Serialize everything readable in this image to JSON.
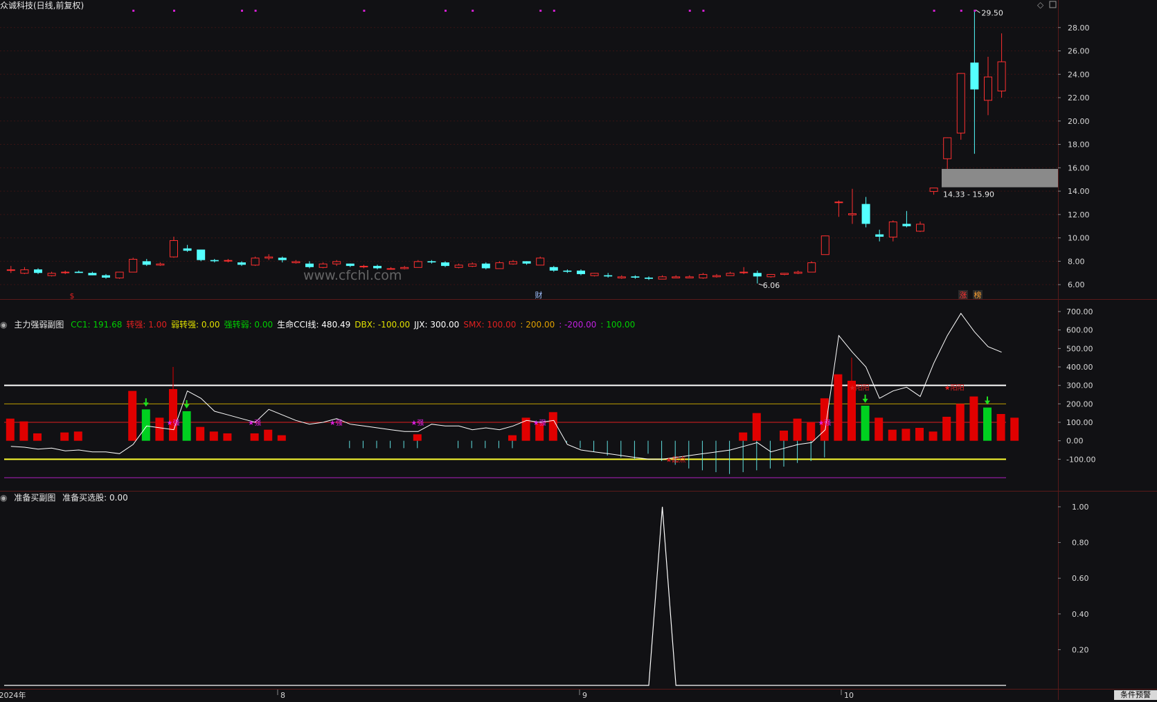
{
  "main_panel": {
    "title": "众诚科技(日线,前复权)",
    "price_axis": [
      "28.00",
      "26.00",
      "24.00",
      "22.00",
      "20.00",
      "18.00",
      "16.00",
      "14.00",
      "12.00",
      "10.00",
      "8.00",
      "6.00"
    ],
    "high_label": "29.50",
    "low_label": "6.06",
    "zone_label": "14.33 - 15.90",
    "markers": {
      "s_label": "$",
      "cai_label": "财",
      "zhang_label": "涨",
      "bang_label": "榜"
    },
    "watermark": "www.cfchl.com"
  },
  "sub_panel1": {
    "name": "主力强弱副图",
    "items": [
      {
        "label": "CC1: 191.68",
        "color": "#00d000"
      },
      {
        "label": "转强: 1.00",
        "color": "#e02020"
      },
      {
        "label": "弱转强: 0.00",
        "color": "#e0e000"
      },
      {
        "label": "强转弱: 0.00",
        "color": "#00d000"
      },
      {
        "label": "生命CCI线: 480.49",
        "color": "#ffffff"
      },
      {
        "label": "DBX: -100.00",
        "color": "#e0e000"
      },
      {
        "label": "JJX: 300.00",
        "color": "#ffffff"
      },
      {
        "label": "SMX: 100.00",
        "color": "#e02020"
      },
      {
        "label": ": 200.00",
        "color": "#e0a000"
      },
      {
        "label": ": -200.00",
        "color": "#c020e0"
      },
      {
        "label": ": 100.00",
        "color": "#00d000"
      }
    ],
    "axis": [
      "700.00",
      "600.00",
      "500.00",
      "400.00",
      "300.00",
      "200.00",
      "100.00",
      "0.00",
      "-100.00"
    ],
    "annotations": {
      "qiang": "★强",
      "huan_yang": "★阳阳",
      "qi_dian": "★起点"
    }
  },
  "sub_panel2": {
    "name": "准备买副图",
    "value_label": "准备买选股: 0.00",
    "axis": [
      "1.00",
      "0.80",
      "0.60",
      "0.40",
      "0.20"
    ]
  },
  "time_axis": [
    "2024年",
    "8",
    "9",
    "10"
  ],
  "corner_button": "条件预警",
  "colors": {
    "up": "#ff3030",
    "down": "#54ffff",
    "bg": "#111114",
    "grid": "#3a1010"
  },
  "chart_data": {
    "type": "candlestick",
    "ylim": [
      5,
      30
    ],
    "candles": [
      {
        "o": 7.3,
        "h": 7.6,
        "l": 7.0,
        "c": 7.3
      },
      {
        "o": 7.0,
        "h": 7.5,
        "l": 6.9,
        "c": 7.3
      },
      {
        "o": 7.3,
        "h": 7.4,
        "l": 6.9,
        "c": 7.0
      },
      {
        "o": 6.8,
        "h": 7.1,
        "l": 6.7,
        "c": 7.0
      },
      {
        "o": 7.1,
        "h": 7.2,
        "l": 6.9,
        "c": 7.1
      },
      {
        "o": 7.1,
        "h": 7.2,
        "l": 7.0,
        "c": 7.0
      },
      {
        "o": 7.0,
        "h": 7.1,
        "l": 6.8,
        "c": 6.8
      },
      {
        "o": 6.8,
        "h": 6.9,
        "l": 6.5,
        "c": 6.6
      },
      {
        "o": 6.6,
        "h": 7.1,
        "l": 6.5,
        "c": 7.1
      },
      {
        "o": 7.1,
        "h": 8.3,
        "l": 7.1,
        "c": 8.2
      },
      {
        "o": 8.0,
        "h": 8.2,
        "l": 7.6,
        "c": 7.7
      },
      {
        "o": 7.7,
        "h": 7.9,
        "l": 7.6,
        "c": 7.8
      },
      {
        "o": 8.4,
        "h": 10.1,
        "l": 8.3,
        "c": 9.8
      },
      {
        "o": 9.1,
        "h": 9.4,
        "l": 8.8,
        "c": 8.9
      },
      {
        "o": 9.0,
        "h": 9.0,
        "l": 8.0,
        "c": 8.1
      },
      {
        "o": 8.1,
        "h": 8.2,
        "l": 7.9,
        "c": 8.0
      },
      {
        "o": 8.1,
        "h": 8.2,
        "l": 7.9,
        "c": 8.1
      },
      {
        "o": 7.9,
        "h": 8.0,
        "l": 7.6,
        "c": 7.7
      },
      {
        "o": 7.7,
        "h": 8.4,
        "l": 7.6,
        "c": 8.3
      },
      {
        "o": 8.3,
        "h": 8.6,
        "l": 8.1,
        "c": 8.4
      },
      {
        "o": 8.3,
        "h": 8.4,
        "l": 7.9,
        "c": 8.1
      },
      {
        "o": 7.9,
        "h": 8.1,
        "l": 7.8,
        "c": 8.0
      },
      {
        "o": 7.8,
        "h": 8.0,
        "l": 7.4,
        "c": 7.5
      },
      {
        "o": 7.5,
        "h": 7.9,
        "l": 7.4,
        "c": 7.8
      },
      {
        "o": 7.8,
        "h": 8.1,
        "l": 7.6,
        "c": 8.0
      },
      {
        "o": 7.8,
        "h": 7.8,
        "l": 7.5,
        "c": 7.6
      },
      {
        "o": 7.6,
        "h": 7.7,
        "l": 7.4,
        "c": 7.6
      },
      {
        "o": 7.6,
        "h": 7.7,
        "l": 7.3,
        "c": 7.4
      },
      {
        "o": 7.4,
        "h": 7.5,
        "l": 7.3,
        "c": 7.4
      },
      {
        "o": 7.4,
        "h": 7.6,
        "l": 7.3,
        "c": 7.5
      },
      {
        "o": 7.5,
        "h": 8.1,
        "l": 7.5,
        "c": 8.0
      },
      {
        "o": 8.0,
        "h": 8.1,
        "l": 7.8,
        "c": 7.9
      },
      {
        "o": 7.9,
        "h": 8.0,
        "l": 7.5,
        "c": 7.6
      },
      {
        "o": 7.5,
        "h": 7.8,
        "l": 7.4,
        "c": 7.7
      },
      {
        "o": 7.6,
        "h": 7.9,
        "l": 7.5,
        "c": 7.8
      },
      {
        "o": 7.8,
        "h": 7.9,
        "l": 7.3,
        "c": 7.4
      },
      {
        "o": 7.4,
        "h": 8.0,
        "l": 7.4,
        "c": 7.9
      },
      {
        "o": 7.8,
        "h": 8.1,
        "l": 7.7,
        "c": 8.0
      },
      {
        "o": 8.0,
        "h": 8.0,
        "l": 7.7,
        "c": 7.8
      },
      {
        "o": 7.7,
        "h": 8.4,
        "l": 7.7,
        "c": 8.3
      },
      {
        "o": 7.5,
        "h": 7.6,
        "l": 7.1,
        "c": 7.2
      },
      {
        "o": 7.2,
        "h": 7.3,
        "l": 7.0,
        "c": 7.1
      },
      {
        "o": 7.2,
        "h": 7.3,
        "l": 6.8,
        "c": 6.9
      },
      {
        "o": 6.8,
        "h": 7.0,
        "l": 6.7,
        "c": 7.0
      },
      {
        "o": 6.8,
        "h": 7.0,
        "l": 6.6,
        "c": 6.7
      },
      {
        "o": 6.6,
        "h": 6.8,
        "l": 6.5,
        "c": 6.7
      },
      {
        "o": 6.7,
        "h": 6.8,
        "l": 6.5,
        "c": 6.6
      },
      {
        "o": 6.6,
        "h": 6.7,
        "l": 6.4,
        "c": 6.5
      },
      {
        "o": 6.5,
        "h": 6.8,
        "l": 6.5,
        "c": 6.7
      },
      {
        "o": 6.6,
        "h": 6.8,
        "l": 6.6,
        "c": 6.7
      },
      {
        "o": 6.6,
        "h": 6.8,
        "l": 6.6,
        "c": 6.7
      },
      {
        "o": 6.6,
        "h": 7.0,
        "l": 6.5,
        "c": 6.9
      },
      {
        "o": 6.7,
        "h": 6.9,
        "l": 6.6,
        "c": 6.8
      },
      {
        "o": 6.8,
        "h": 7.1,
        "l": 6.8,
        "c": 7.0
      },
      {
        "o": 7.1,
        "h": 7.5,
        "l": 6.9,
        "c": 7.1
      },
      {
        "o": 7.0,
        "h": 7.2,
        "l": 6.1,
        "c": 6.7
      },
      {
        "o": 6.7,
        "h": 6.9,
        "l": 6.6,
        "c": 6.9
      },
      {
        "o": 6.9,
        "h": 7.0,
        "l": 6.8,
        "c": 7.0
      },
      {
        "o": 7.0,
        "h": 7.2,
        "l": 6.9,
        "c": 7.1
      },
      {
        "o": 7.1,
        "h": 8.0,
        "l": 7.1,
        "c": 7.9
      },
      {
        "o": 8.6,
        "h": 10.2,
        "l": 8.6,
        "c": 10.2
      },
      {
        "o": 13.1,
        "h": 13.2,
        "l": 11.8,
        "c": 13.1
      },
      {
        "o": 12.0,
        "h": 14.2,
        "l": 11.2,
        "c": 12.1
      },
      {
        "o": 12.9,
        "h": 13.5,
        "l": 10.9,
        "c": 11.2
      },
      {
        "o": 10.3,
        "h": 10.7,
        "l": 9.7,
        "c": 10.1
      },
      {
        "o": 10.1,
        "h": 11.5,
        "l": 9.7,
        "c": 11.4
      },
      {
        "o": 11.2,
        "h": 12.3,
        "l": 10.9,
        "c": 11.0
      },
      {
        "o": 10.6,
        "h": 11.4,
        "l": 10.5,
        "c": 11.2
      },
      {
        "o": 14.0,
        "h": 14.3,
        "l": 13.7,
        "c": 14.3
      },
      {
        "o": 16.8,
        "h": 18.6,
        "l": 15.9,
        "c": 18.6
      },
      {
        "o": 19.0,
        "h": 24.1,
        "l": 18.4,
        "c": 24.1
      },
      {
        "o": 25.0,
        "h": 29.5,
        "l": 17.2,
        "c": 22.7
      },
      {
        "o": 21.8,
        "h": 25.5,
        "l": 20.5,
        "c": 23.8
      },
      {
        "o": 22.6,
        "h": 27.5,
        "l": 22.0,
        "c": 25.1
      }
    ],
    "cc1": [
      120,
      105,
      40,
      0,
      45,
      50,
      0,
      0,
      0,
      270,
      170,
      125,
      280,
      160,
      75,
      50,
      40,
      0,
      40,
      60,
      30,
      0,
      0,
      0,
      0,
      0,
      0,
      0,
      0,
      0,
      35,
      0,
      0,
      0,
      0,
      0,
      0,
      30,
      125,
      95,
      155,
      0,
      0,
      0,
      0,
      0,
      0,
      0,
      0,
      0,
      0,
      0,
      0,
      0,
      45,
      150,
      0,
      55,
      120,
      100,
      230,
      360,
      325,
      190,
      125,
      60,
      65,
      70,
      50,
      130,
      200,
      240,
      180,
      145,
      125
    ],
    "cc1_colors": [
      0,
      0,
      0,
      0,
      0,
      0,
      0,
      0,
      0,
      0,
      1,
      0,
      0,
      1,
      0,
      0,
      0,
      0,
      0,
      0,
      0,
      0,
      0,
      0,
      0,
      0,
      0,
      0,
      0,
      0,
      0,
      0,
      0,
      0,
      0,
      0,
      0,
      0,
      0,
      0,
      0,
      0,
      0,
      0,
      0,
      0,
      0,
      0,
      0,
      0,
      0,
      0,
      0,
      0,
      0,
      0,
      0,
      0,
      0,
      0,
      0,
      0,
      0,
      1,
      0,
      0,
      0,
      0,
      0,
      0,
      0,
      0,
      1,
      0,
      0
    ],
    "cyan_lines": [
      -10,
      -40,
      -60,
      -80,
      -90,
      -100,
      -70,
      -110,
      -130,
      -150,
      -160,
      -170,
      -180,
      -170,
      -160,
      -150,
      -140,
      -120,
      -110,
      -90
    ],
    "life_cci": [
      -30,
      -35,
      -45,
      -40,
      -55,
      -50,
      -60,
      -60,
      -70,
      -20,
      80,
      70,
      60,
      270,
      230,
      160,
      140,
      120,
      100,
      170,
      140,
      110,
      90,
      100,
      120,
      90,
      80,
      70,
      60,
      50,
      50,
      90,
      80,
      80,
      60,
      70,
      60,
      80,
      110,
      100,
      110,
      -20,
      -50,
      -60,
      -70,
      -80,
      -90,
      -100,
      -100,
      -90,
      -80,
      -70,
      -60,
      -50,
      -30,
      -10,
      -60,
      -40,
      -20,
      -10,
      60,
      570,
      480,
      400,
      230,
      270,
      290,
      240,
      420,
      570,
      690,
      590,
      510,
      480
    ],
    "dbx": -100,
    "jjx": 300,
    "smx": 100,
    "line200": 200,
    "line_neg200": -200,
    "buy_signal": {
      "index": 48,
      "value": 1.0
    }
  }
}
